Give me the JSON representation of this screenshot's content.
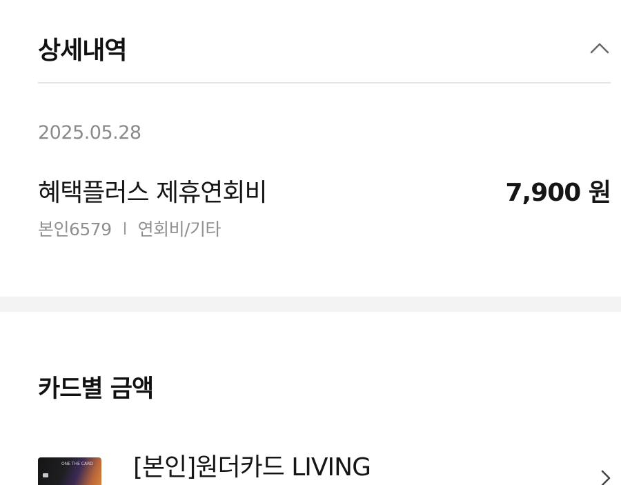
{
  "detail": {
    "title": "상세내역",
    "collapse_icon": "chevron-up-icon",
    "transaction": {
      "date": "2025.05.28",
      "name": "혜택플러스 제휴연회비",
      "amount": "7,900 원",
      "owner": "본인6579",
      "category": "연회비/기타"
    }
  },
  "card_amounts": {
    "title": "카드별 금액",
    "card": {
      "name": "[본인]원더카드 LIVING",
      "thumb_text": "ONE THE CARD",
      "chevron_icon": "chevron-right-icon"
    }
  },
  "colors": {
    "background": "#ffffff",
    "text_primary": "#111111",
    "text_secondary": "#8a8a8a",
    "divider": "#e5e5e5",
    "band": "#f3f3f3"
  }
}
